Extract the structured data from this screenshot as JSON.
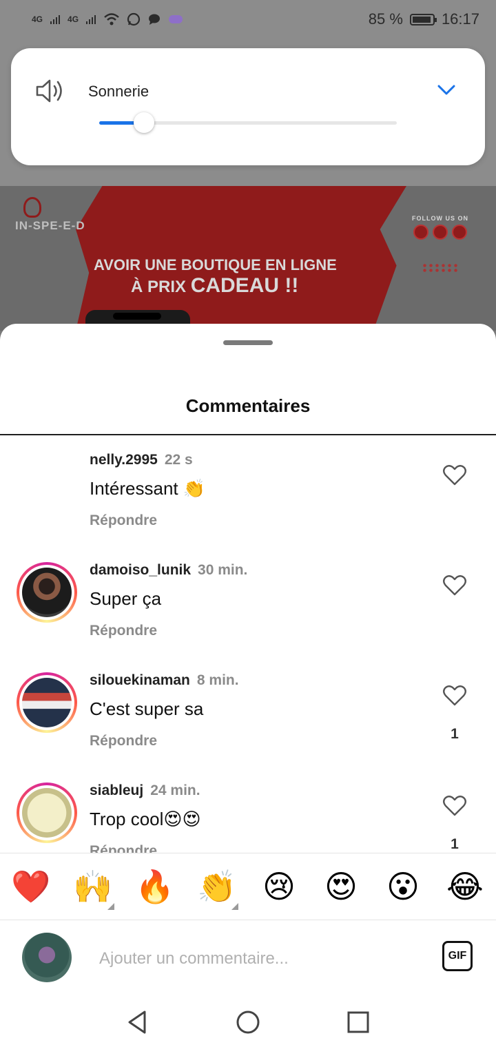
{
  "status_bar": {
    "network": [
      "4G",
      "4G"
    ],
    "battery": "85 %",
    "time": "16:17"
  },
  "volume_panel": {
    "label": "Sonnerie",
    "level": 0.15,
    "accent": "#1a73e8"
  },
  "background_ad": {
    "logo": "IN-SPE-E-D",
    "follow": "FOLLOW US ON",
    "line1": "AVOIR UNE BOUTIQUE EN LIGNE",
    "line2_prefix": "À PRIX",
    "line2_bold": "CADEAU !!"
  },
  "comments_sheet": {
    "title": "Commentaires",
    "comments": [
      {
        "user": "nelly.2995",
        "time": "22 s",
        "text": "Intéressant 👏",
        "reply": "Répondre",
        "likes": ""
      },
      {
        "user": "damoiso_lunik",
        "time": "30 min.",
        "text": "Super ça",
        "reply": "Répondre",
        "likes": ""
      },
      {
        "user": "silouekinaman",
        "time": "8 min.",
        "text": "C'est super sa",
        "reply": "Répondre",
        "likes": "1"
      },
      {
        "user": "siableuj",
        "time": "24 min.",
        "text": "Trop cool😍😍",
        "reply": "Répondre",
        "likes": "1"
      }
    ],
    "reactions": [
      "❤️",
      "🙌",
      "🔥",
      "👏",
      "😢",
      "😍",
      "😮",
      "😂"
    ],
    "composer": {
      "placeholder": "Ajouter un commentaire...",
      "gif_label": "GIF"
    }
  },
  "icons": {
    "volume": "speaker-icon",
    "chevron": "chevron-down-icon",
    "like": "heart-icon",
    "nav": [
      "back-icon",
      "home-icon",
      "recents-icon"
    ]
  }
}
